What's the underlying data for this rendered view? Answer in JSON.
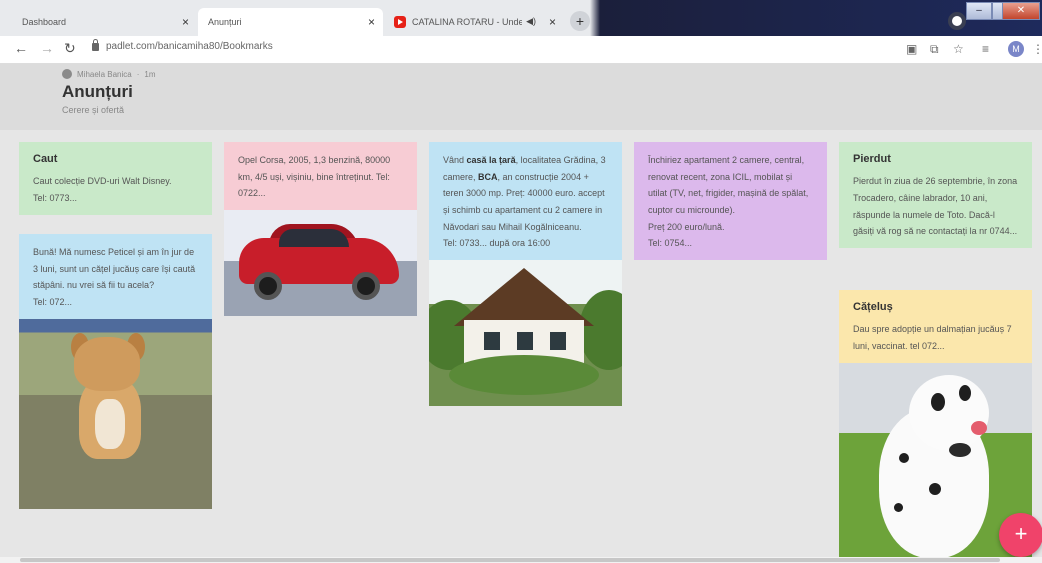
{
  "browser": {
    "tabs": [
      {
        "label": "Dashboard",
        "favicon": "padlet-favicon"
      },
      {
        "label": "Anunțuri",
        "favicon": "padlet-favicon"
      },
      {
        "label": "CATALINA ROTARU - Unde",
        "favicon": "youtube-favicon"
      }
    ],
    "new_tab": "+",
    "url": "padlet.com/banicamiha80/Bookmarks",
    "profile_initial": "M",
    "window_controls": {
      "minimize": "–",
      "maximize": "□",
      "close": "✕"
    }
  },
  "header": {
    "author": "Mihaela Banica",
    "time": "1m",
    "title": "Anunțuri",
    "subtitle": "Cerere și ofertă"
  },
  "cards": {
    "caut": {
      "title": "Caut",
      "text": "Caut colecție DVD-uri Walt Disney.",
      "tel": "Tel: 0773..."
    },
    "peticel": {
      "line1": "Bună! Mă numesc Peticel și am în jur de 3 luni, sunt un cățel jucăuș care își caută stăpâni. nu vrei să fii tu acela?",
      "tel": "Tel: 072..."
    },
    "opel": {
      "text": "Opel Corsa, 2005, 1,3 benzină, 80000 km, 4/5 uși, vișiniu, bine întreținut. Tel: 0722..."
    },
    "casa": {
      "prefix": "Vând ",
      "bold1": "casă la țară",
      "mid1": ", localitatea Grădina, 3 camere, ",
      "bold2": "BCA",
      "rest": ", an construcție 2004 + teren 3000 mp. Preț: 40000 euro. accept și schimb cu apartament cu 2 camere in Năvodari sau Mihail Kogălniceanu.",
      "tel": "Tel: 0733... după ora 16:00"
    },
    "apartament": {
      "text": "Închiriez apartament 2 camere, central, renovat recent, zona ICIL, mobilat și utilat (TV, net, frigider, mașină de spălat, cuptor cu microunde).",
      "price": "Preț 200 euro/lună.",
      "tel": "Tel: 0754..."
    },
    "pierdut": {
      "title": "Pierdut",
      "text": "Pierdut în ziua de 26 septembrie, în zona Trocadero, câine labrador, 10 ani, răspunde la numele de Toto. Dacă-l găsiți vă rog să ne contactați la nr 0744..."
    },
    "catelus": {
      "title": "Cățeluș",
      "text": "Dau spre adopție un dalmațian jucăuș 7 luni, vaccinat. tel 072..."
    }
  },
  "fab_label": "+",
  "colors": {
    "green": "#c9e9c9",
    "blue": "#bfe3f4",
    "pink": "#f7ccd4",
    "purple": "#dcb9ec",
    "yellow": "#fbe7ac",
    "fab": "#f0436a"
  }
}
